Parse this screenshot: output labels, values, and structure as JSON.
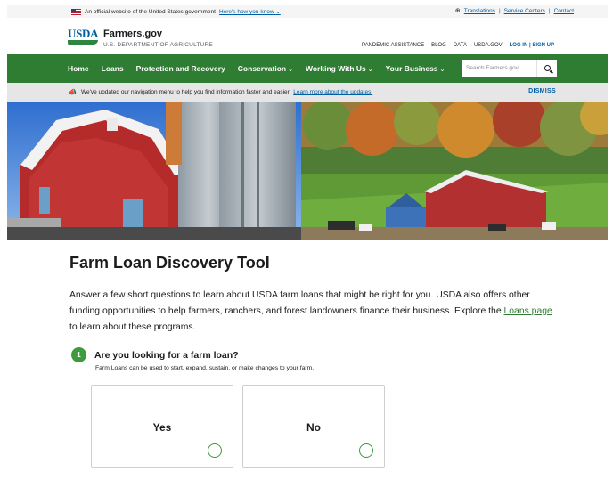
{
  "gov_banner": {
    "official_text": "An official website of the United States government",
    "how_you_know": "Here's how you know",
    "links": [
      "Translations",
      "Service Centers",
      "Contact"
    ]
  },
  "header": {
    "logo_text": "USDA",
    "site_name": "Farmers.gov",
    "department": "U.S. DEPARTMENT OF AGRICULTURE",
    "utility_links": [
      "PANDEMIC ASSISTANCE",
      "BLOG",
      "DATA",
      "USDA.GOV"
    ],
    "login_label": "LOG IN | SIGN UP"
  },
  "nav": {
    "items": [
      {
        "label": "Home",
        "has_menu": false,
        "active": false
      },
      {
        "label": "Loans",
        "has_menu": false,
        "active": true
      },
      {
        "label": "Protection and Recovery",
        "has_menu": false,
        "active": false
      },
      {
        "label": "Conservation",
        "has_menu": true,
        "active": false
      },
      {
        "label": "Working With Us",
        "has_menu": true,
        "active": false
      },
      {
        "label": "Your Business",
        "has_menu": true,
        "active": false
      }
    ],
    "search_placeholder": "Search Farmers.gov"
  },
  "notice": {
    "text": "We've updated our navigation menu to help you find information faster and easier.",
    "link": "Learn more about the updates.",
    "dismiss": "DISMISS"
  },
  "main": {
    "title": "Farm Loan Discovery Tool",
    "intro_before": "Answer a few short questions to learn about USDA farm loans that might be right for you. USDA also offers other funding opportunities to help farmers, ranchers, and forest landowners finance their business. Explore the ",
    "intro_link": "Loans page",
    "intro_after": " to learn about these programs."
  },
  "question": {
    "number": "1",
    "title": "Are you looking for a farm loan?",
    "hint": "Farm Loans can be used to start, expand, sustain, or make changes to your farm.",
    "options": [
      "Yes",
      "No"
    ]
  },
  "colors": {
    "nav_green": "#2e7d32",
    "link_blue": "#005ea2",
    "accent_green": "#3d9b3d"
  },
  "icons": {
    "flag": "us-flag-icon",
    "globe": "globe-icon",
    "megaphone": "megaphone-icon",
    "search": "search-icon",
    "chevron": "chevron-down-icon"
  }
}
